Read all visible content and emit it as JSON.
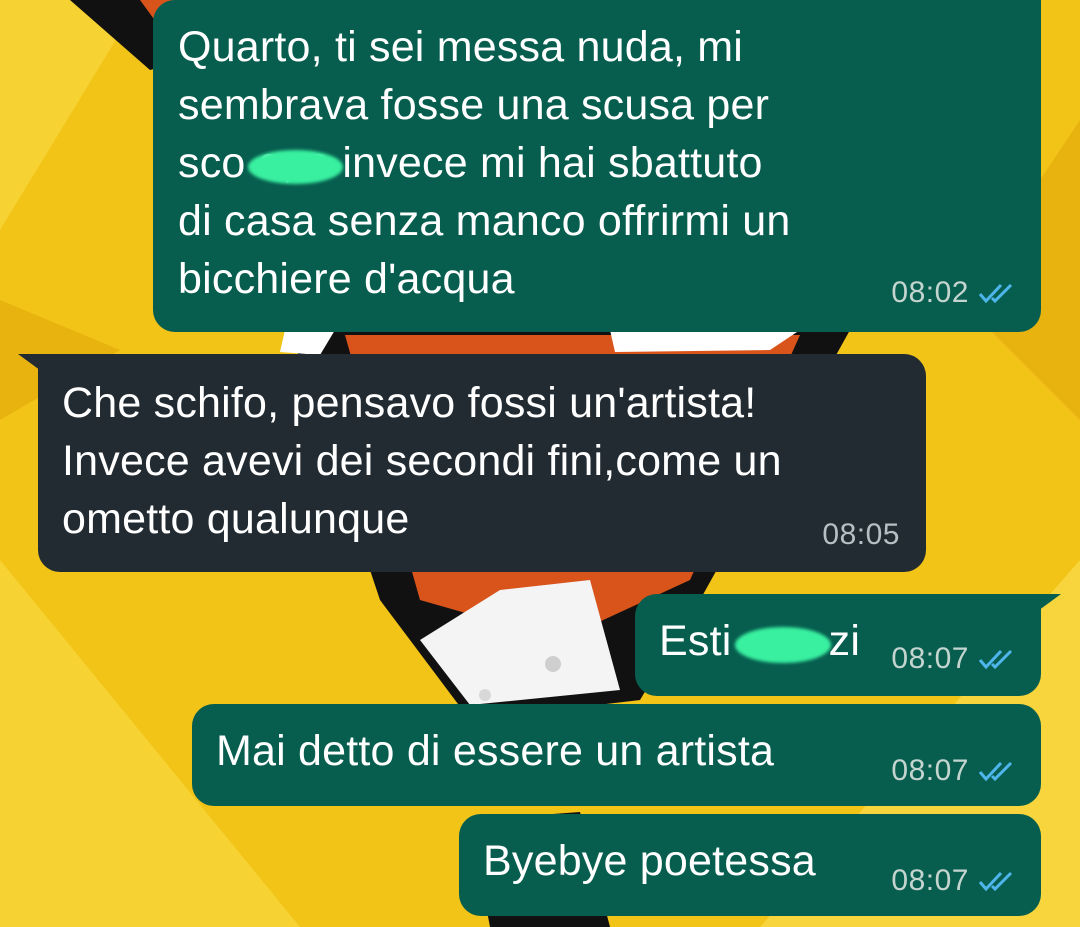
{
  "colors": {
    "wallpaper_yellow": "#f2c418",
    "outgoing_bubble": "#075e4f",
    "incoming_bubble": "#222b31",
    "read_ticks": "#4fb6ec",
    "redaction": "#39f0a0"
  },
  "messages": [
    {
      "direction": "outgoing",
      "text": "Quarto, ti sei messa nuda, mi\nsembrava fosse una scusa per\nsco      e, e invece mi hai sbattuto\ndi casa senza manco offrirmi un\nbicchiere d'acqua",
      "time": "08:02",
      "status_icon": "double-check-read-icon"
    },
    {
      "direction": "incoming",
      "text": "Che schifo, pensavo fossi un'artista!\nInvece avevi dei secondi fini,come un\nometto qualunque",
      "time": "08:05"
    },
    {
      "direction": "outgoing",
      "text": "Esti        zi",
      "time": "08:07",
      "status_icon": "double-check-read-icon"
    },
    {
      "direction": "outgoing",
      "text": "Mai detto di essere un artista",
      "time": "08:07",
      "status_icon": "double-check-read-icon"
    },
    {
      "direction": "outgoing",
      "text": "Byebye poetessa",
      "time": "08:07",
      "status_icon": "double-check-read-icon"
    }
  ]
}
